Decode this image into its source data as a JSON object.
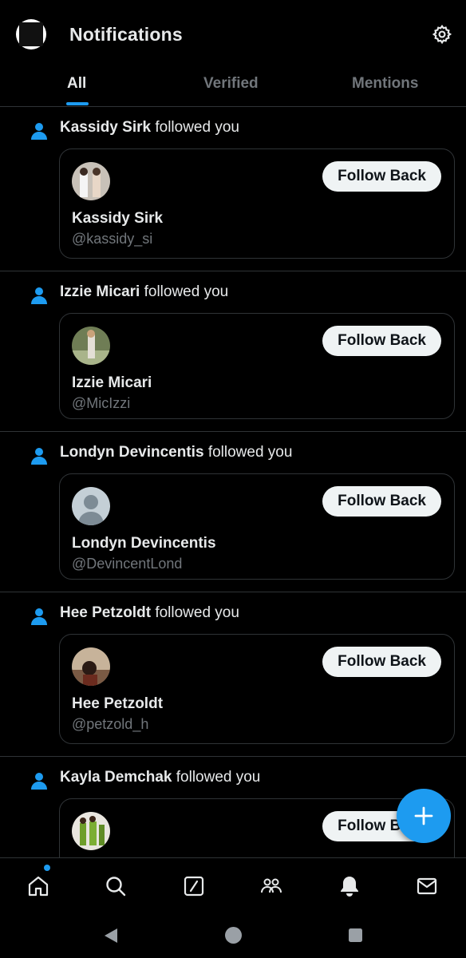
{
  "header": {
    "title": "Notifications",
    "icons": [
      "profile-avatar",
      "gear-icon"
    ]
  },
  "tabs": [
    {
      "label": "All",
      "active": true
    },
    {
      "label": "Verified",
      "active": false
    },
    {
      "label": "Mentions",
      "active": false
    }
  ],
  "notifications": [
    {
      "name": "Kassidy Sirk",
      "action": "followed you",
      "handle": "@kassidy_si",
      "button": "Follow Back"
    },
    {
      "name": "Izzie Micari",
      "action": "followed you",
      "handle": "@MicIzzi",
      "button": "Follow Back"
    },
    {
      "name": "Londyn Devincentis",
      "action": "followed you",
      "handle": "@DevincentLond",
      "button": "Follow Back"
    },
    {
      "name": "Hee Petzoldt",
      "action": "followed you",
      "handle": "@petzold_h",
      "button": "Follow Back"
    },
    {
      "name": "Kayla Demchak",
      "action": "followed you",
      "handle": "",
      "button": "Follow Back"
    }
  ],
  "bottom_nav": [
    "home-icon",
    "search-icon",
    "grok-icon",
    "communities-icon",
    "notifications-icon",
    "messages-icon"
  ],
  "colors": {
    "accent": "#1d9bf0",
    "background": "#000000",
    "muted": "#71767b",
    "divider": "#2f3336"
  }
}
